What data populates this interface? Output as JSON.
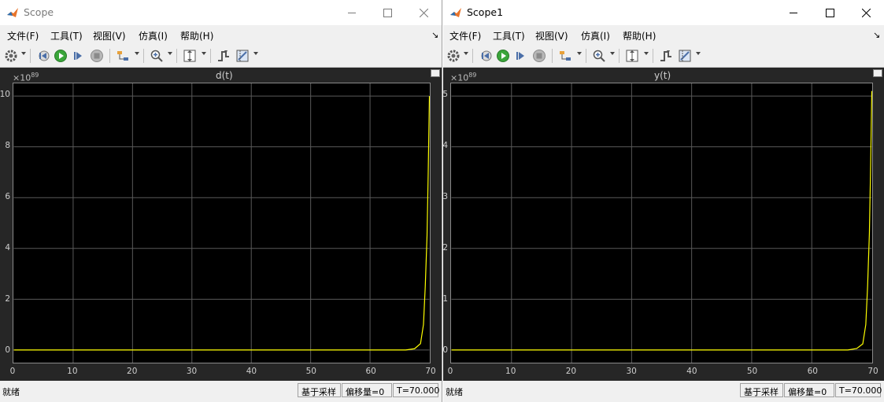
{
  "menu": [
    "文件(F)",
    "工具(T)",
    "视图(V)",
    "仿真(I)",
    "帮助(H)"
  ],
  "windows": [
    {
      "title": "Scope",
      "plot_title": "d(t)",
      "exponent_base": "×10",
      "exponent_power": "89",
      "y_ticks": [
        "10",
        "8",
        "6",
        "4",
        "2",
        "0"
      ],
      "x_ticks": [
        "0",
        "10",
        "20",
        "30",
        "40",
        "50",
        "60",
        "70"
      ],
      "status": {
        "ready": "就绪",
        "mode": "基于采样",
        "offset": "偏移量=0",
        "time": "T=70.000"
      }
    },
    {
      "title": "Scope1",
      "plot_title": "y(t)",
      "exponent_base": "×10",
      "exponent_power": "89",
      "y_ticks": [
        "5",
        "4",
        "3",
        "2",
        "1",
        "0"
      ],
      "x_ticks": [
        "0",
        "10",
        "20",
        "30",
        "40",
        "50",
        "60",
        "70"
      ],
      "status": {
        "ready": "就绪",
        "mode": "基于采样",
        "offset": "偏移量=0",
        "time": "T=70.000"
      }
    }
  ],
  "colors": {
    "trace": "#ffff00",
    "axes_bg": "#000000",
    "figure_bg": "#262626",
    "grid": "#5a5a5a"
  },
  "chart_data": [
    {
      "type": "line",
      "title": "d(t)",
      "xlim": [
        0,
        70
      ],
      "ylim": [
        -0.5,
        10.5
      ],
      "y_scale_factor": "1e89",
      "grid": true,
      "series": [
        {
          "x": [
            0,
            66,
            67.5,
            68.5,
            69,
            69.3,
            69.6,
            69.8,
            70
          ],
          "y": [
            0,
            0,
            0.05,
            0.25,
            1.0,
            2.5,
            4.5,
            7.0,
            10.0
          ]
        }
      ]
    },
    {
      "type": "line",
      "title": "y(t)",
      "xlim": [
        0,
        70
      ],
      "ylim": [
        -0.25,
        5.25
      ],
      "y_scale_factor": "1e89",
      "grid": true,
      "series": [
        {
          "x": [
            0,
            66,
            67.5,
            68.5,
            69,
            69.3,
            69.6,
            69.8,
            70
          ],
          "y": [
            0,
            0,
            0.03,
            0.12,
            0.5,
            1.25,
            2.3,
            3.6,
            5.1
          ]
        }
      ]
    }
  ]
}
